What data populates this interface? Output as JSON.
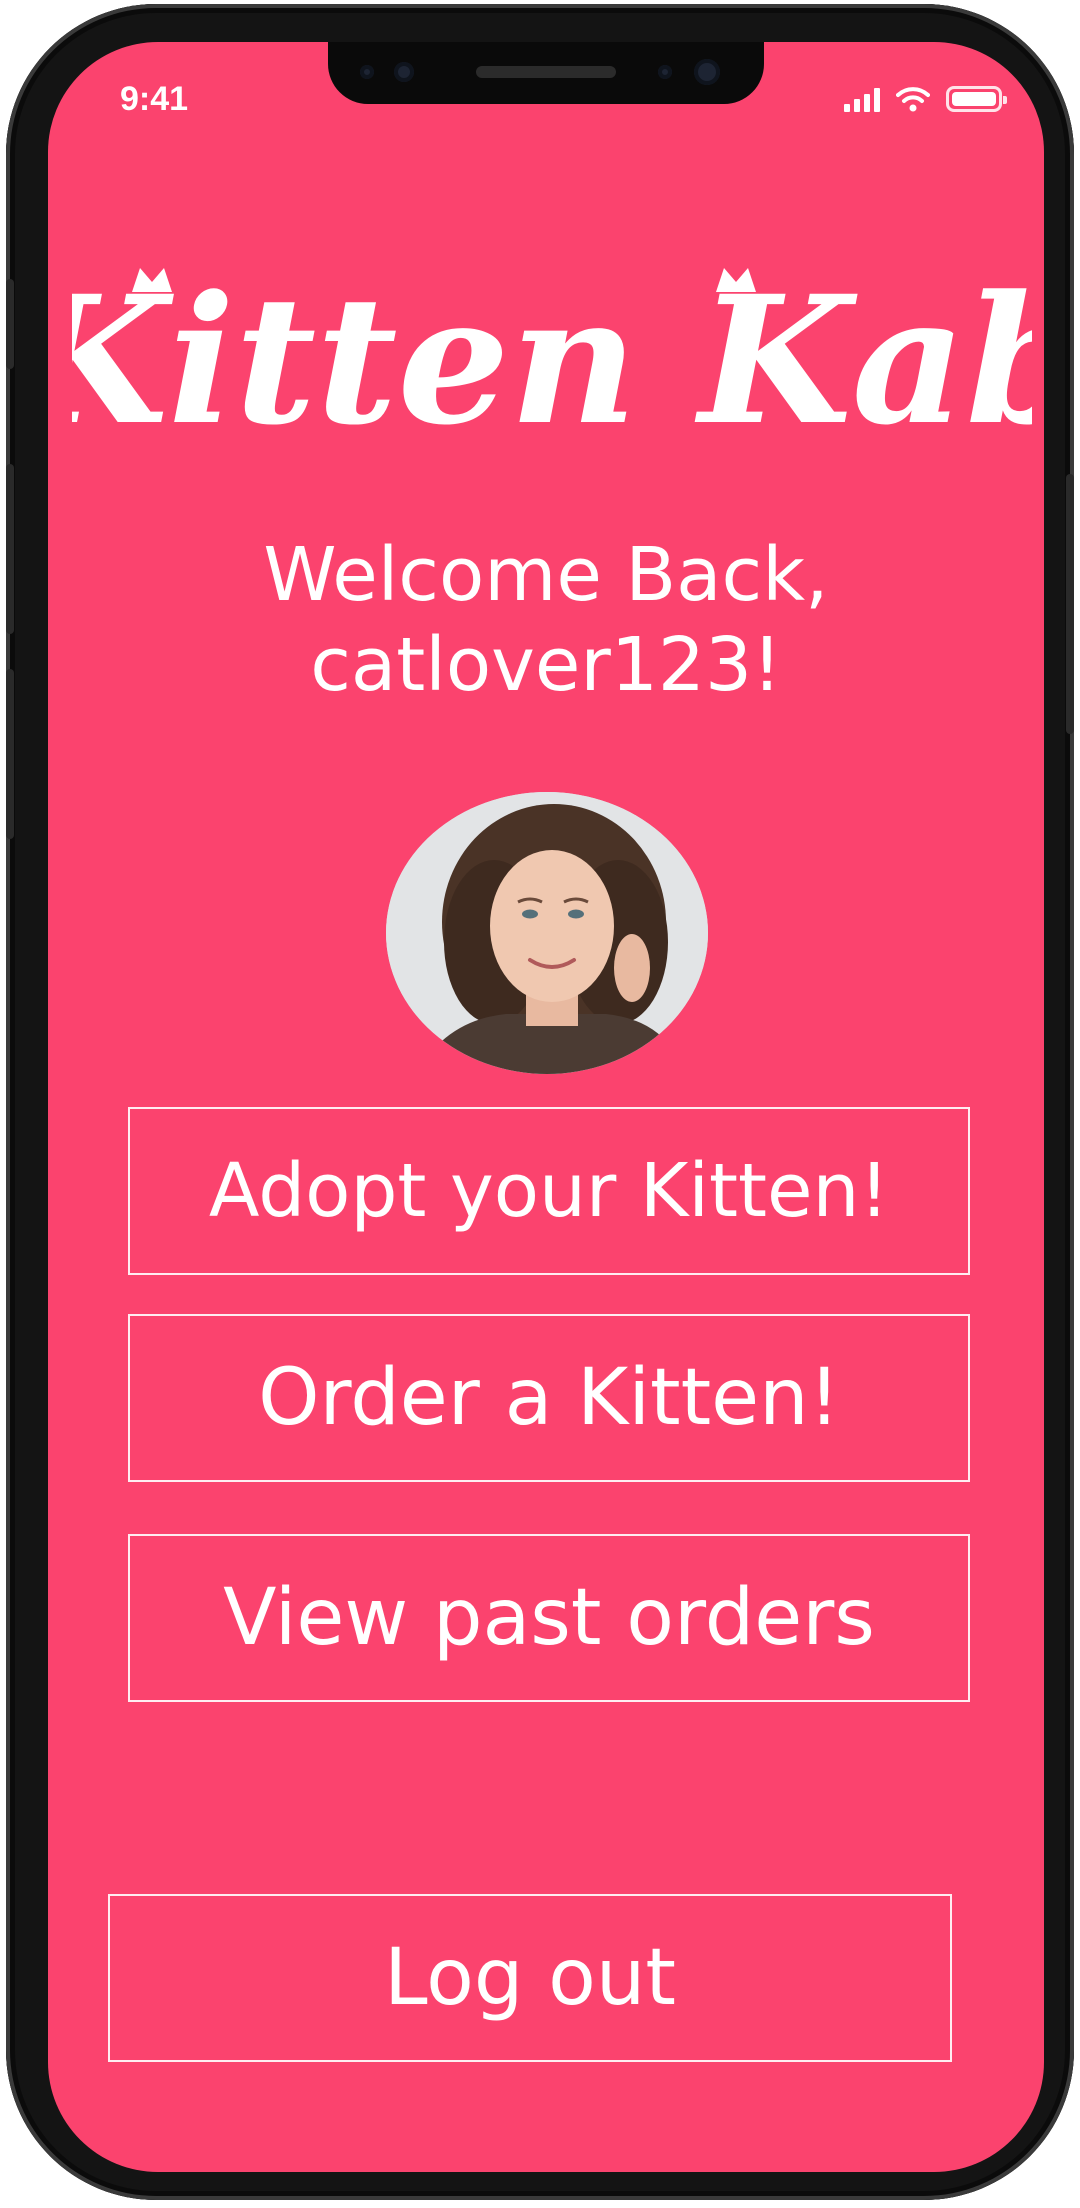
{
  "status_bar": {
    "time": "9:41",
    "icons": [
      "cellular-signal-icon",
      "wifi-icon",
      "battery-icon"
    ]
  },
  "brand": {
    "app_name": "Kitten Kab"
  },
  "welcome": {
    "line1": "Welcome Back,",
    "line2": "catlover123!"
  },
  "profile": {
    "avatar": "user-avatar-photo"
  },
  "menu": {
    "adopt_label": "Adopt your Kitten!",
    "order_label": "Order a Kitten!",
    "past_orders_label": "View past orders",
    "logout_label": "Log out"
  },
  "colors": {
    "background": "#fb436e",
    "text": "#ffffff",
    "frame": "#141414"
  }
}
